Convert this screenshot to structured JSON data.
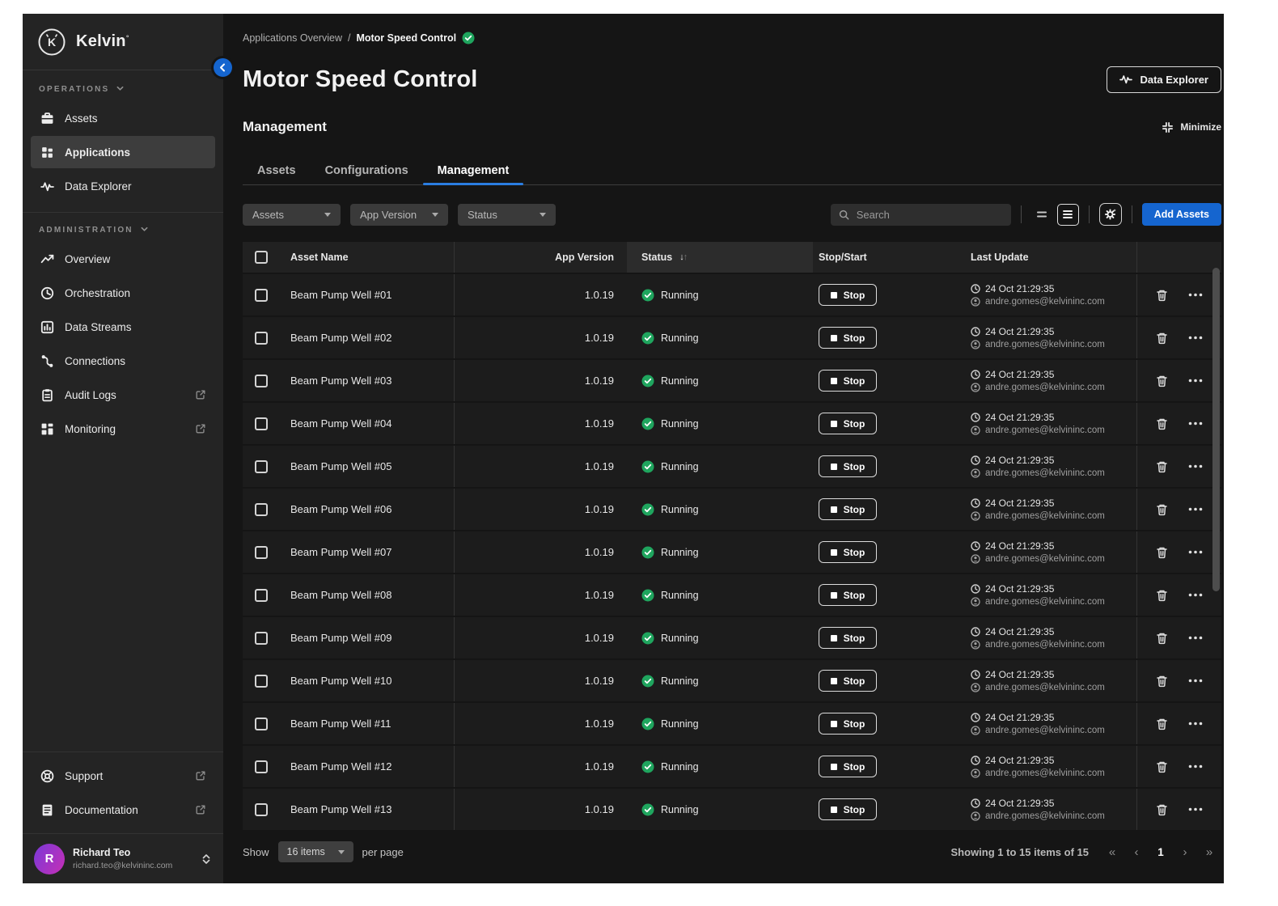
{
  "colors": {
    "accent_blue": "#1565cf",
    "tab_underline": "#2a7de1",
    "status_green": "#1fa55e",
    "avatar_from": "#7a39d8",
    "avatar_to": "#c62fb5"
  },
  "sidebar": {
    "brand": "Kelvin",
    "sections": [
      {
        "label": "OPERATIONS",
        "items": [
          {
            "label": "Assets",
            "icon": "assets"
          },
          {
            "label": "Applications",
            "icon": "applications",
            "active": true
          },
          {
            "label": "Data Explorer",
            "icon": "waveform"
          }
        ]
      },
      {
        "label": "ADMINISTRATION",
        "items": [
          {
            "label": "Overview",
            "icon": "overview"
          },
          {
            "label": "Orchestration",
            "icon": "orchestration"
          },
          {
            "label": "Data Streams",
            "icon": "data-streams"
          },
          {
            "label": "Connections",
            "icon": "connections"
          },
          {
            "label": "Audit Logs",
            "icon": "audit-logs",
            "external": true
          },
          {
            "label": "Monitoring",
            "icon": "monitoring",
            "external": true
          }
        ]
      }
    ],
    "footer_items": [
      {
        "label": "Support",
        "icon": "support",
        "external": true
      },
      {
        "label": "Documentation",
        "icon": "documentation",
        "external": true
      }
    ],
    "profile": {
      "initial": "R",
      "name": "Richard Teo",
      "email": "richard.teo@kelvininc.com"
    }
  },
  "header": {
    "breadcrumb": {
      "parent": "Applications Overview",
      "separator": "/",
      "current": "Motor Speed Control"
    },
    "title": "Motor Speed Control",
    "data_explorer_button": "Data Explorer",
    "section_title": "Management",
    "minimize_label": "Minimize"
  },
  "tabs": [
    {
      "label": "Assets"
    },
    {
      "label": "Configurations"
    },
    {
      "label": "Management",
      "active": true
    }
  ],
  "toolbar": {
    "filters": [
      "Assets",
      "App Version",
      "Status"
    ],
    "search_placeholder": "Search",
    "add_button": "Add Assets"
  },
  "table": {
    "columns": {
      "asset_name": "Asset Name",
      "app_version": "App Version",
      "status": "Status",
      "stop_start": "Stop/Start",
      "last_update": "Last Update"
    },
    "rows": [
      {
        "name": "Beam Pump Well #01",
        "version": "1.0.19",
        "status": "Running",
        "action": "Stop",
        "updated": "24 Oct 21:29:35",
        "updated_by": "andre.gomes@kelvininc.com"
      },
      {
        "name": "Beam Pump Well #02",
        "version": "1.0.19",
        "status": "Running",
        "action": "Stop",
        "updated": "24 Oct 21:29:35",
        "updated_by": "andre.gomes@kelvininc.com"
      },
      {
        "name": "Beam Pump Well #03",
        "version": "1.0.19",
        "status": "Running",
        "action": "Stop",
        "updated": "24 Oct 21:29:35",
        "updated_by": "andre.gomes@kelvininc.com"
      },
      {
        "name": "Beam Pump Well #04",
        "version": "1.0.19",
        "status": "Running",
        "action": "Stop",
        "updated": "24 Oct 21:29:35",
        "updated_by": "andre.gomes@kelvininc.com"
      },
      {
        "name": "Beam Pump Well #05",
        "version": "1.0.19",
        "status": "Running",
        "action": "Stop",
        "updated": "24 Oct 21:29:35",
        "updated_by": "andre.gomes@kelvininc.com"
      },
      {
        "name": "Beam Pump Well #06",
        "version": "1.0.19",
        "status": "Running",
        "action": "Stop",
        "updated": "24 Oct 21:29:35",
        "updated_by": "andre.gomes@kelvininc.com"
      },
      {
        "name": "Beam Pump Well #07",
        "version": "1.0.19",
        "status": "Running",
        "action": "Stop",
        "updated": "24 Oct 21:29:35",
        "updated_by": "andre.gomes@kelvininc.com"
      },
      {
        "name": "Beam Pump Well #08",
        "version": "1.0.19",
        "status": "Running",
        "action": "Stop",
        "updated": "24 Oct 21:29:35",
        "updated_by": "andre.gomes@kelvininc.com"
      },
      {
        "name": "Beam Pump Well #09",
        "version": "1.0.19",
        "status": "Running",
        "action": "Stop",
        "updated": "24 Oct 21:29:35",
        "updated_by": "andre.gomes@kelvininc.com"
      },
      {
        "name": "Beam Pump Well #10",
        "version": "1.0.19",
        "status": "Running",
        "action": "Stop",
        "updated": "24 Oct 21:29:35",
        "updated_by": "andre.gomes@kelvininc.com"
      },
      {
        "name": "Beam Pump Well #11",
        "version": "1.0.19",
        "status": "Running",
        "action": "Stop",
        "updated": "24 Oct 21:29:35",
        "updated_by": "andre.gomes@kelvininc.com"
      },
      {
        "name": "Beam Pump Well #12",
        "version": "1.0.19",
        "status": "Running",
        "action": "Stop",
        "updated": "24 Oct 21:29:35",
        "updated_by": "andre.gomes@kelvininc.com"
      },
      {
        "name": "Beam Pump Well #13",
        "version": "1.0.19",
        "status": "Running",
        "action": "Stop",
        "updated": "24 Oct 21:29:35",
        "updated_by": "andre.gomes@kelvininc.com"
      }
    ]
  },
  "footer": {
    "show_label": "Show",
    "page_size": "16 items",
    "per_page_label": "per page",
    "summary": "Showing 1 to 15 items of 15",
    "page": "1"
  }
}
